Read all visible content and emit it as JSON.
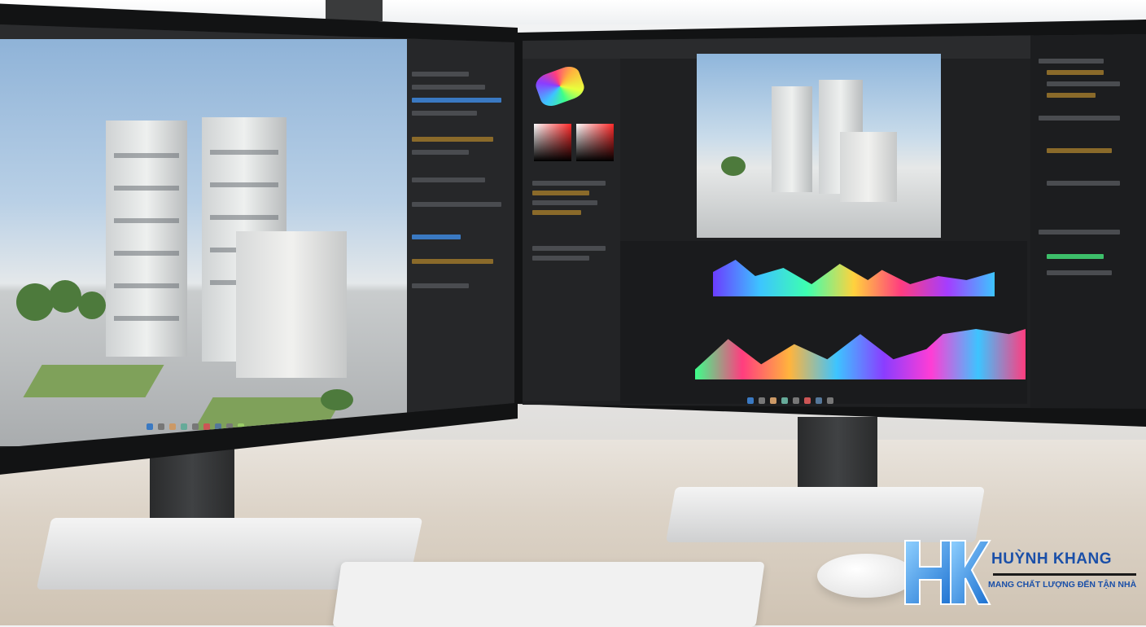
{
  "brand": {
    "name": "HUỲNH KHANG",
    "tagline": "MANG CHẤT LƯỢNG ĐẾN TẬN NHÀ",
    "mark": "HK",
    "colors": {
      "primary": "#1a4fa8",
      "light": "#3b9be8"
    }
  },
  "scene": {
    "left_monitor": {
      "app": "3D architectural modeling software",
      "subject": "two-tower building render"
    },
    "right_monitor": {
      "app": "creative editing software",
      "subject": "building render with color waveform timelines"
    }
  },
  "colors": {
    "desk": "#dcd3c7",
    "wall": "#eeeff0",
    "bezel": "#121314",
    "ui_dark": "#1f2022"
  }
}
